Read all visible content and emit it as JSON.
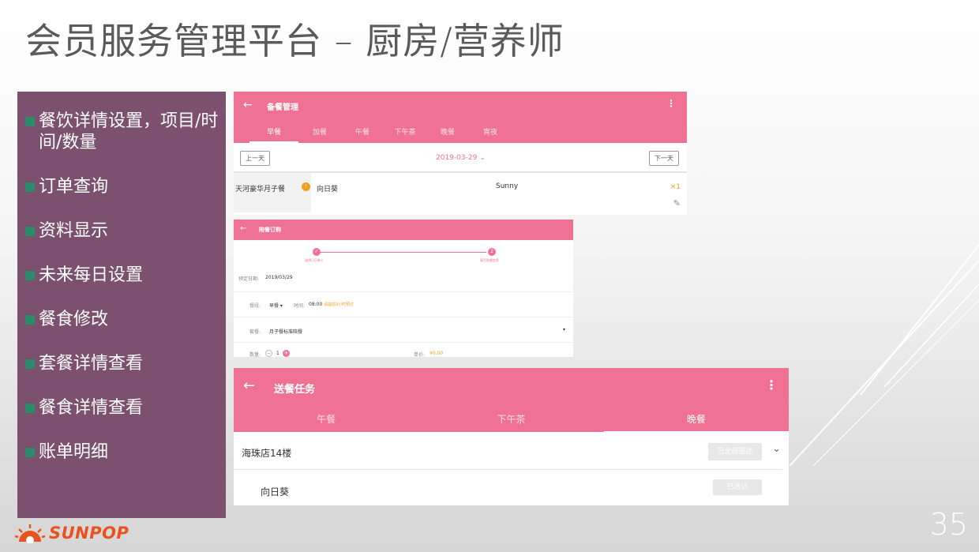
{
  "slide": {
    "title": "会员服务管理平台 – 厨房/营养师",
    "page_number": "35",
    "logo_text": "SUNPOP"
  },
  "side_menu": [
    "餐饮详情设置，项目/时间/数量",
    "订单查询",
    "资料显示",
    "未来每日设置",
    "餐食修改",
    "套餐详情查看",
    "餐食详情查看",
    "账单明细"
  ],
  "screen1": {
    "title": "备餐管理",
    "tabs": [
      "早餐",
      "加餐",
      "午餐",
      "下午茶",
      "晚餐",
      "宵夜"
    ],
    "prev_label": "上一天",
    "next_label": "下一天",
    "date": "2019-03-29",
    "package": "天河豪华月子餐",
    "badge": "!",
    "meal": "向日葵",
    "customer": "Sunny",
    "quantity": "×1"
  },
  "screen2": {
    "title": "陪餐订购",
    "step1_label": "选择日日单人",
    "step2_label": "填写陪餐信息",
    "step2_num": "2",
    "book_date_label": "预定日期:",
    "book_date_value": "2019/03/29",
    "period_label": "餐段:",
    "period_value": "早餐",
    "time_label": "时间:",
    "time_value": "08:00",
    "time_hint": "请提前3小时预订",
    "set_label": "套餐:",
    "set_value": "月子餐标准陪餐",
    "qty_label": "数量:",
    "qty_value": "1",
    "price_label": "单价:",
    "price_value": "¥0.00"
  },
  "screen3": {
    "title": "送餐任务",
    "tabs": [
      "午餐",
      "下午茶",
      "晚餐"
    ],
    "active_tab": "晚餐",
    "shop": "海珠店14楼",
    "shop_button": "已全部送达",
    "item": "向日葵",
    "item_button": "已送达"
  },
  "colors": {
    "accent": "#ef7194",
    "panel": "#7c5170",
    "bullet": "#2a8a6a",
    "logo": "#e8521e"
  }
}
